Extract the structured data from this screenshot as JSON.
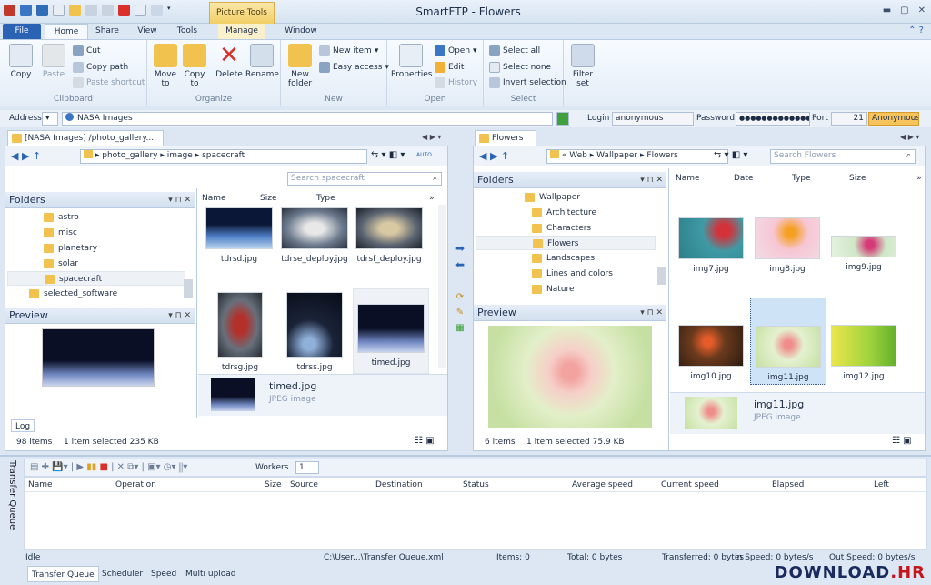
{
  "app_title": "SmartFTP - Flowers",
  "context_tab": "Picture Tools",
  "menu_tabs": [
    "File",
    "Home",
    "Share",
    "View",
    "Tools",
    "Manage",
    "Window"
  ],
  "ribbon": {
    "clipboard": {
      "copy": "Copy",
      "paste": "Paste",
      "cut": "Cut",
      "copy_path": "Copy path",
      "paste_shortcut": "Paste shortcut",
      "label": "Clipboard"
    },
    "organize": {
      "move": "Move",
      "move_to": "to",
      "copy": "Copy",
      "copy_to": "to",
      "delete": "Delete",
      "rename": "Rename",
      "label": "Organize"
    },
    "new": {
      "new_folder1": "New",
      "new_folder2": "folder",
      "new_item": "New item",
      "easy_access": "Easy access",
      "label": "New"
    },
    "open": {
      "properties": "Properties",
      "open": "Open",
      "edit": "Edit",
      "history": "History",
      "label": "Open"
    },
    "select": {
      "select_all": "Select all",
      "select_none": "Select none",
      "invert": "Invert selection",
      "label": "Select"
    },
    "filter": {
      "filter1": "Filter",
      "filter2": "set"
    }
  },
  "address": {
    "label": "Address",
    "value": "NASA Images",
    "login_label": "Login",
    "login_value": "anonymous",
    "password_label": "Password",
    "password_value": "●●●●●●●●●●●●●●",
    "port_label": "Port",
    "port_value": "21",
    "anon": "Anonymous"
  },
  "left": {
    "tab": "[NASA Images] /photo_gallery...",
    "path": [
      "photo_gallery",
      "image",
      "spacecraft"
    ],
    "search_placeholder": "Search spacecraft",
    "folders_title": "Folders",
    "folders": [
      "astro",
      "misc",
      "planetary",
      "solar",
      "spacecraft",
      "selected_software"
    ],
    "preview_title": "Preview",
    "cols": [
      "Name",
      "Size",
      "Type"
    ],
    "files": [
      "tdrsd.jpg",
      "tdrse_deploy.jpg",
      "tdrsf_deploy.jpg",
      "tdrsg.jpg",
      "tdrss.jpg",
      "timed.jpg"
    ],
    "info_name": "timed.jpg",
    "info_type": "JPEG image",
    "log_tab": "Log",
    "status_items": "98 items",
    "status_sel": "1 item selected  235 KB"
  },
  "right": {
    "tab": "Flowers",
    "path": [
      "Web",
      "Wallpaper",
      "Flowers"
    ],
    "search_placeholder": "Search Flowers",
    "folders_title": "Folders",
    "folders": [
      "Wallpaper",
      "Architecture",
      "Characters",
      "Flowers",
      "Landscapes",
      "Lines and colors",
      "Nature"
    ],
    "preview_title": "Preview",
    "cols": [
      "Name",
      "Date",
      "Type",
      "Size"
    ],
    "files": [
      "img7.jpg",
      "img8.jpg",
      "img9.jpg",
      "img10.jpg",
      "img11.jpg",
      "img12.jpg"
    ],
    "info_name": "img11.jpg",
    "info_type": "JPEG image",
    "status_items": "6 items",
    "status_sel": "1 item selected  75.9 KB"
  },
  "queue": {
    "side_label": "Transfer Queue",
    "workers_label": "Workers",
    "workers_value": "1",
    "cols": [
      "Name",
      "Operation",
      "Size",
      "Source",
      "Destination",
      "Status",
      "Average speed",
      "Current speed",
      "Elapsed",
      "Left"
    ],
    "status": [
      "Idle",
      "C:\\User...\\Transfer Queue.xml",
      "Items: 0",
      "Total: 0 bytes",
      "Transferred: 0 bytes",
      "In Speed: 0 bytes/s",
      "Out Speed: 0 bytes/s"
    ],
    "tabs": [
      "Transfer Queue",
      "Scheduler",
      "Speed",
      "Multi upload"
    ]
  },
  "watermark": {
    "a": "DOWNLOAD",
    "b": ".HR"
  }
}
